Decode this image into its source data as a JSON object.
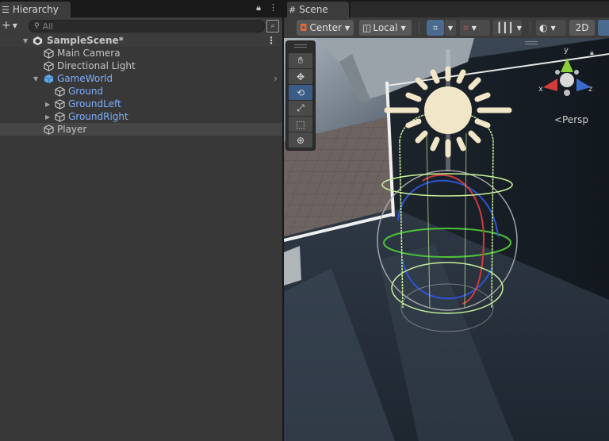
{
  "hierarchy": {
    "tab_label": "Hierarchy",
    "tab_icon": "list-icon",
    "lock_icon": "lock-icon",
    "menu_icon": "kebab-icon",
    "add_icon": "plus-icon",
    "search": {
      "placeholder": "All"
    },
    "scene": {
      "name": "SampleScene*"
    },
    "items": [
      {
        "label": "Main Camera"
      },
      {
        "label": "Directional Light"
      },
      {
        "label": "GameWorld"
      },
      {
        "label": "Ground"
      },
      {
        "label": "GroundLeft"
      },
      {
        "label": "GroundRight"
      },
      {
        "label": "Player"
      }
    ]
  },
  "scene_view": {
    "tab_label": "Scene",
    "tab_icon": "grid-icon",
    "toolbar": {
      "pivot_label": "Center",
      "space_label": "Local",
      "mode_2d_label": "2D"
    },
    "tools": [
      "hand-icon",
      "move-icon",
      "rotate-icon",
      "scale-icon",
      "rect-icon",
      "transform-icon"
    ],
    "active_tool": "rotate-icon",
    "gizmo": {
      "axis_x": "x",
      "axis_y": "y",
      "axis_z": "z",
      "projection_label": "Persp"
    }
  },
  "colors": {
    "accent": "#3a5c87",
    "selected_text": "#7dafff",
    "x_axis": "#d23b3b",
    "y_axis": "#8ccd3a",
    "z_axis": "#3a6bd2"
  }
}
